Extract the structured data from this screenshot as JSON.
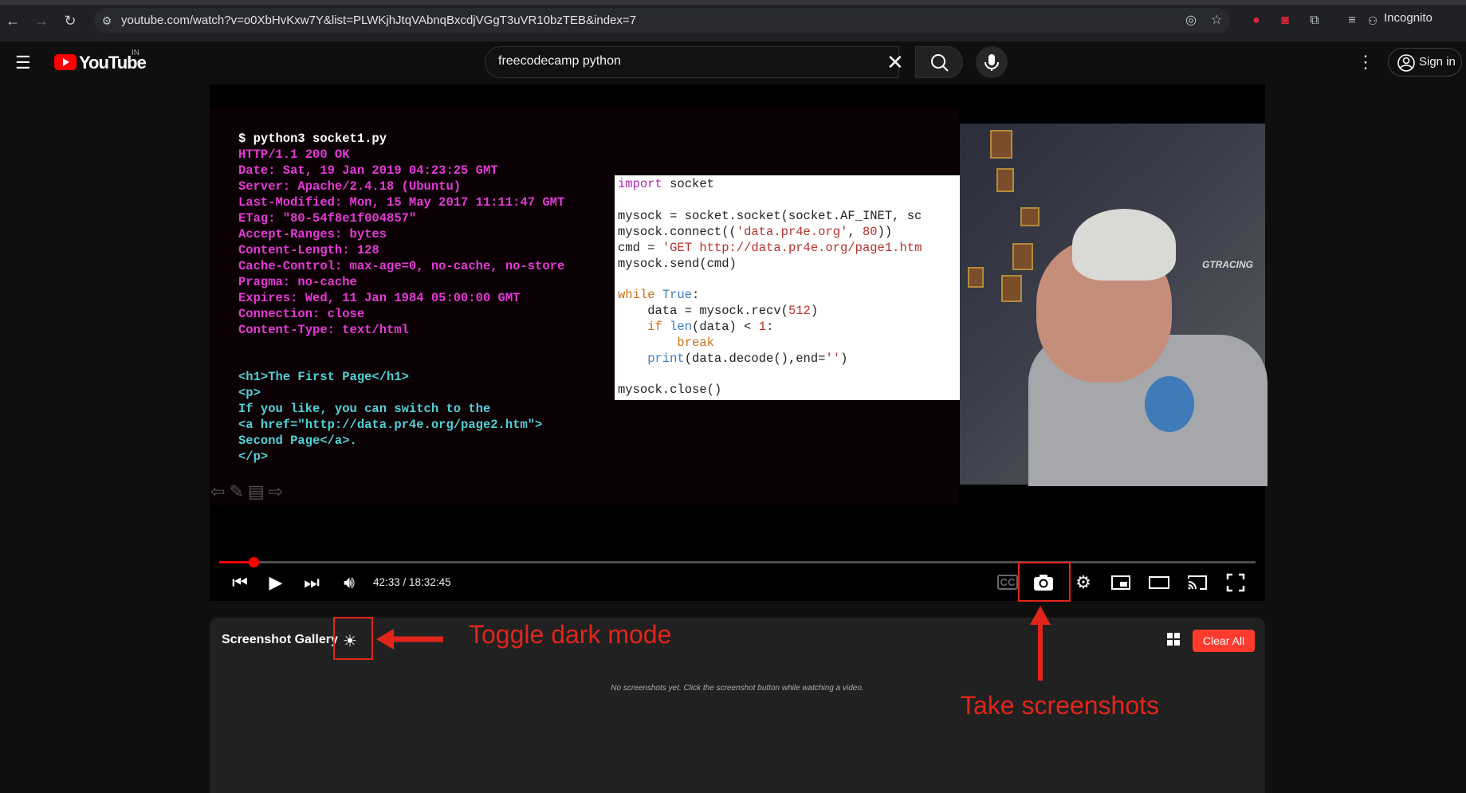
{
  "browser": {
    "url": "youtube.com/watch?v=o0XbHvKxw7Y&list=PLWKjhJtqVAbnqBxcdjVGgT3uVR10bzTEB&index=7",
    "incognito_label": "Incognito"
  },
  "youtube": {
    "logo_text": "YouTube",
    "country_code": "IN",
    "search_value": "freecodecamp python",
    "signin_label": "Sign in"
  },
  "slide": {
    "terminal": [
      {
        "text": "$ python3 socket1.py",
        "color": "wht"
      },
      {
        "text": "HTTP/1.1 200 OK",
        "color": "mag"
      },
      {
        "text": "Date: Sat, 19 Jan 2019 04:23:25 GMT",
        "color": "mag"
      },
      {
        "text": "Server: Apache/2.4.18 (Ubuntu)",
        "color": "mag"
      },
      {
        "text": "Last-Modified: Mon, 15 May 2017 11:11:47 GMT",
        "color": "mag"
      },
      {
        "text": "ETag: \"80-54f8e1f004857\"",
        "color": "mag"
      },
      {
        "text": "Accept-Ranges: bytes",
        "color": "mag"
      },
      {
        "text": "Content-Length: 128",
        "color": "mag"
      },
      {
        "text": "Cache-Control: max-age=0, no-cache, no-store",
        "color": "mag"
      },
      {
        "text": "Pragma: no-cache",
        "color": "mag"
      },
      {
        "text": "Expires: Wed, 11 Jan 1984 05:00:00 GMT",
        "color": "mag"
      },
      {
        "text": "Connection: close",
        "color": "mag"
      },
      {
        "text": "Content-Type: text/html",
        "color": "mag"
      }
    ],
    "html_lines": [
      "<h1>The First Page</h1>",
      "<p>",
      "If you like, you can switch to the",
      "<a href=\"http://data.pr4e.org/page2.htm\">",
      "Second Page</a>.",
      "</p>"
    ],
    "chair_brand": "GTRACING"
  },
  "code": {
    "line1_kw": "import",
    "line1_rest": " socket",
    "line2": "mysock = socket.socket(socket.AF_INET, sc",
    "line3_a": "mysock.connect((",
    "line3_str": "'data.pr4e.org'",
    "line3_b": ", ",
    "line3_num": "80",
    "line3_c": "))",
    "line4_a": "cmd = ",
    "line4_str": "'GET http://data.pr4e.org/page1.htm",
    "line5": "mysock.send(cmd)",
    "line6_kw": "while",
    "line6_true": "True",
    "line6_c": ":",
    "line7_a": "    data = mysock.recv(",
    "line7_num": "512",
    "line7_c": ")",
    "line8_kw": "    if",
    "line8_bi": "len",
    "line8_b": "(data) < ",
    "line8_num": "1",
    "line8_c": ":",
    "line9_kw": "        break",
    "line10_bi": "    print",
    "line10_b": "(data.decode(),end=",
    "line10_str": "''",
    "line10_c": ")",
    "line11": "mysock.close()"
  },
  "player": {
    "time_display": "42:33 / 18:32:45",
    "progress_fraction": 0.033
  },
  "gallery": {
    "title": "Screenshot Gallery",
    "empty_message": "No screenshots yet. Click the screenshot button while watching a video.",
    "clear_all_label": "Clear All"
  },
  "annotations": {
    "toggle_dark": "Toggle dark mode",
    "take_screenshots": "Take screenshots"
  },
  "colors": {
    "annotation_red": "#e1251b",
    "youtube_red": "#ff0000",
    "clear_button": "#ff3b30"
  }
}
